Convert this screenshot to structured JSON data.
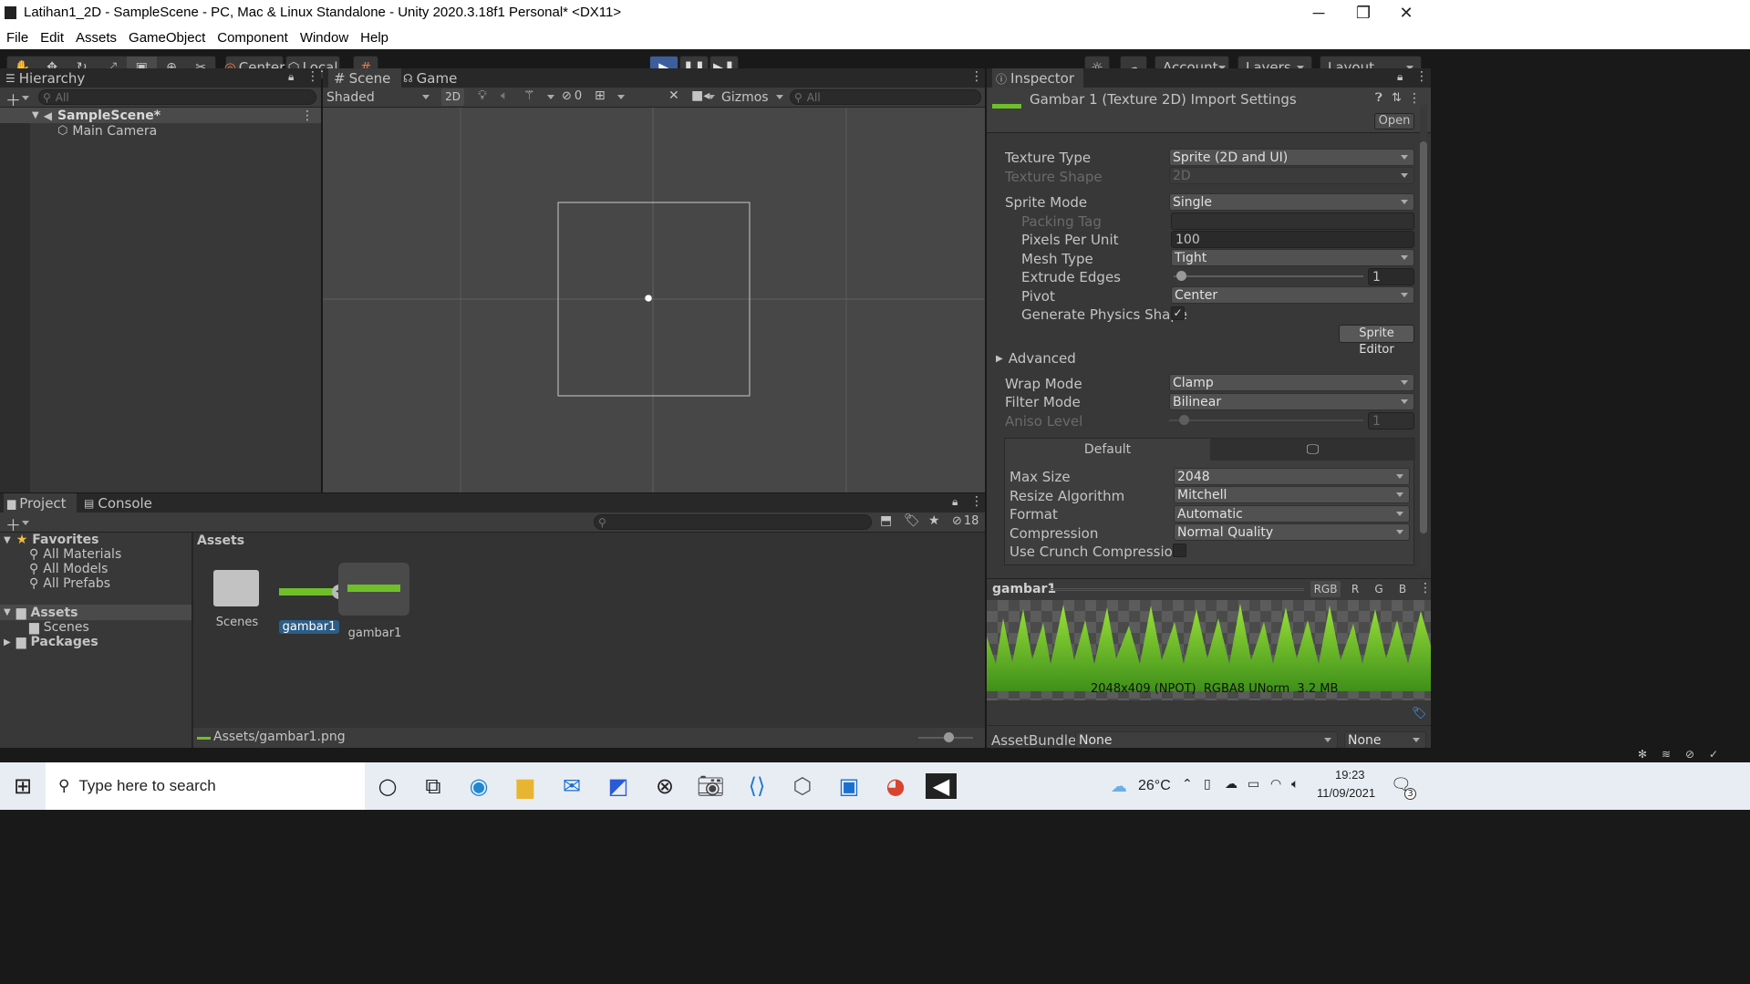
{
  "window": {
    "title": "Latihan1_2D - SampleScene - PC, Mac & Linux Standalone - Unity 2020.3.18f1 Personal* <DX11>"
  },
  "menu": [
    "File",
    "Edit",
    "Assets",
    "GameObject",
    "Component",
    "Window",
    "Help"
  ],
  "toolbar": {
    "center_label": "Center",
    "local_label": "Local",
    "account_label": "Account",
    "layers_label": "Layers",
    "layout_label": "Layout"
  },
  "hierarchy": {
    "tab": "Hierarchy",
    "search_placeholder": "All",
    "scene": "SampleScene*",
    "items": [
      "Main Camera"
    ]
  },
  "scene_view": {
    "tab_scene": "Scene",
    "tab_game": "Game",
    "shading": "Shaded",
    "mode_2d": "2D",
    "hidden_count": "0",
    "gizmos": "Gizmos",
    "search_placeholder": "All"
  },
  "project": {
    "tab_project": "Project",
    "tab_console": "Console",
    "hidden_count": "18",
    "favorites_label": "Favorites",
    "favorites": [
      "All Materials",
      "All Models",
      "All Prefabs"
    ],
    "assets_label": "Assets",
    "scenes_label": "Scenes",
    "packages_label": "Packages",
    "breadcrumb": "Assets",
    "files": [
      "Scenes",
      "gambar1",
      "gambar1"
    ],
    "status_path": "Assets/gambar1.png"
  },
  "inspector": {
    "tab": "Inspector",
    "header_title": "Gambar 1 (Texture 2D) Import Settings",
    "open_button": "Open",
    "rows": {
      "texture_type": {
        "label": "Texture Type",
        "value": "Sprite (2D and UI)"
      },
      "texture_shape": {
        "label": "Texture Shape",
        "value": "2D"
      },
      "sprite_mode": {
        "label": "Sprite Mode",
        "value": "Single"
      },
      "packing_tag": {
        "label": "Packing Tag",
        "value": ""
      },
      "ppu": {
        "label": "Pixels Per Unit",
        "value": "100"
      },
      "mesh_type": {
        "label": "Mesh Type",
        "value": "Tight"
      },
      "extrude": {
        "label": "Extrude Edges",
        "value": "1"
      },
      "pivot": {
        "label": "Pivot",
        "value": "Center"
      },
      "physics": {
        "label": "Generate Physics Shape",
        "value": "✓"
      },
      "wrap": {
        "label": "Wrap Mode",
        "value": "Clamp"
      },
      "filter": {
        "label": "Filter Mode",
        "value": "Bilinear"
      },
      "aniso": {
        "label": "Aniso Level",
        "value": "1"
      }
    },
    "sprite_editor": "Sprite Editor",
    "advanced": "Advanced",
    "platform_default": "Default",
    "platform": {
      "max_size": {
        "label": "Max Size",
        "value": "2048"
      },
      "resize": {
        "label": "Resize Algorithm",
        "value": "Mitchell"
      },
      "format": {
        "label": "Format",
        "value": "Automatic"
      },
      "compression": {
        "label": "Compression",
        "value": "Normal Quality"
      },
      "crunch": {
        "label": "Use Crunch Compression"
      }
    },
    "preview": {
      "name": "gambar1",
      "channels": [
        "RGB",
        "R",
        "G",
        "B"
      ],
      "info": "2048x409 (NPOT)  RGBA8 UNorm  3.2 MB"
    },
    "assetbundle": {
      "label": "AssetBundle",
      "value": "None",
      "variant": "None"
    }
  },
  "taskbar": {
    "search_placeholder": "Type here to search",
    "temp": "26°C",
    "time": "19:23",
    "date": "11/09/2021",
    "notifications": "3"
  },
  "colors": {
    "unity_bg": "#383838",
    "panel_dark": "#282828",
    "play_active": "#3c5e9d",
    "selection": "#2c5d87"
  }
}
